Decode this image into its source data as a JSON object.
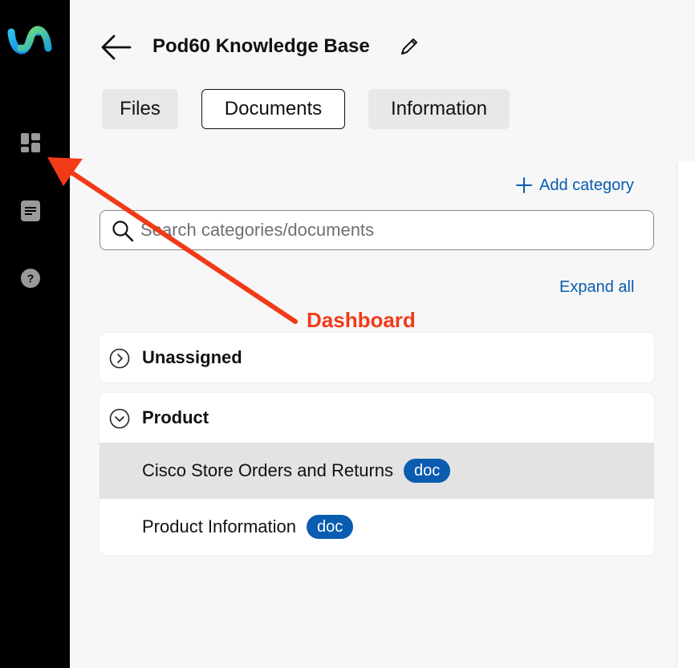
{
  "sidebar": {
    "items": [
      {
        "name": "dashboard",
        "icon": "dashboard-grid-icon"
      },
      {
        "name": "documents",
        "icon": "document-icon"
      },
      {
        "name": "help",
        "icon": "help-icon"
      }
    ],
    "logo": "webex-logo"
  },
  "header": {
    "title": "Pod60 Knowledge Base",
    "back_icon": "arrow-left-icon",
    "edit_icon": "pencil-icon"
  },
  "tabs": [
    {
      "label": "Files",
      "active": false
    },
    {
      "label": "Documents",
      "active": true
    },
    {
      "label": "Information",
      "active": false
    }
  ],
  "actions": {
    "add_category_label": "Add category",
    "expand_all_label": "Expand all"
  },
  "search": {
    "placeholder": "Search categories/documents",
    "value": ""
  },
  "categories": [
    {
      "name": "Unassigned",
      "expanded": false,
      "documents": []
    },
    {
      "name": "Product",
      "expanded": true,
      "documents": [
        {
          "name": "Cisco Store Orders and Returns",
          "badge": "doc",
          "selected": true
        },
        {
          "name": "Product Information",
          "badge": "doc",
          "selected": false
        }
      ]
    }
  ],
  "annotation": {
    "label": "Dashboard",
    "color": "#f23a19"
  },
  "colors": {
    "accent": "#0a5cb0",
    "sidebar_bg": "#000000",
    "annotation": "#f23a19"
  }
}
